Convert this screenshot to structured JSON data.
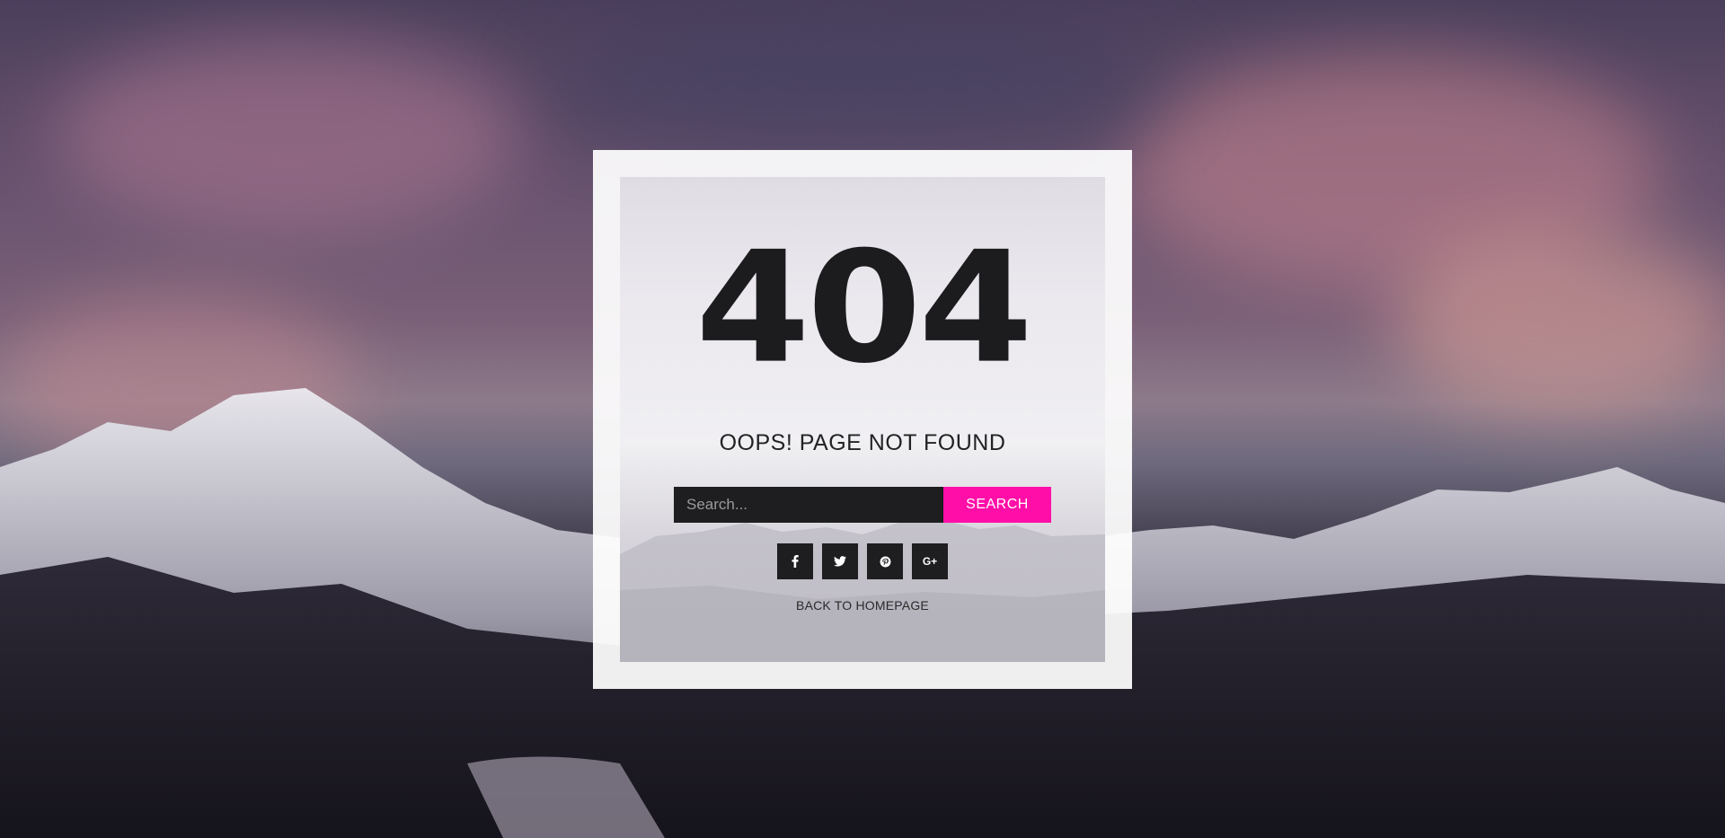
{
  "error": {
    "code": "404",
    "message": "OOPS! PAGE NOT FOUND"
  },
  "search": {
    "placeholder": "Search...",
    "value": "",
    "button_label": "SEARCH"
  },
  "social": {
    "items": [
      {
        "icon": "facebook-icon",
        "glyph": "f"
      },
      {
        "icon": "twitter-icon",
        "glyph": "t"
      },
      {
        "icon": "pinterest-icon",
        "glyph": "p"
      },
      {
        "icon": "google-plus-icon",
        "glyph": "G+"
      }
    ]
  },
  "back_link": {
    "label": "BACK TO HOMEPAGE"
  },
  "colors": {
    "accent": "#ff0fa8",
    "dark": "#1e1e20",
    "panel": "#ffffff"
  }
}
